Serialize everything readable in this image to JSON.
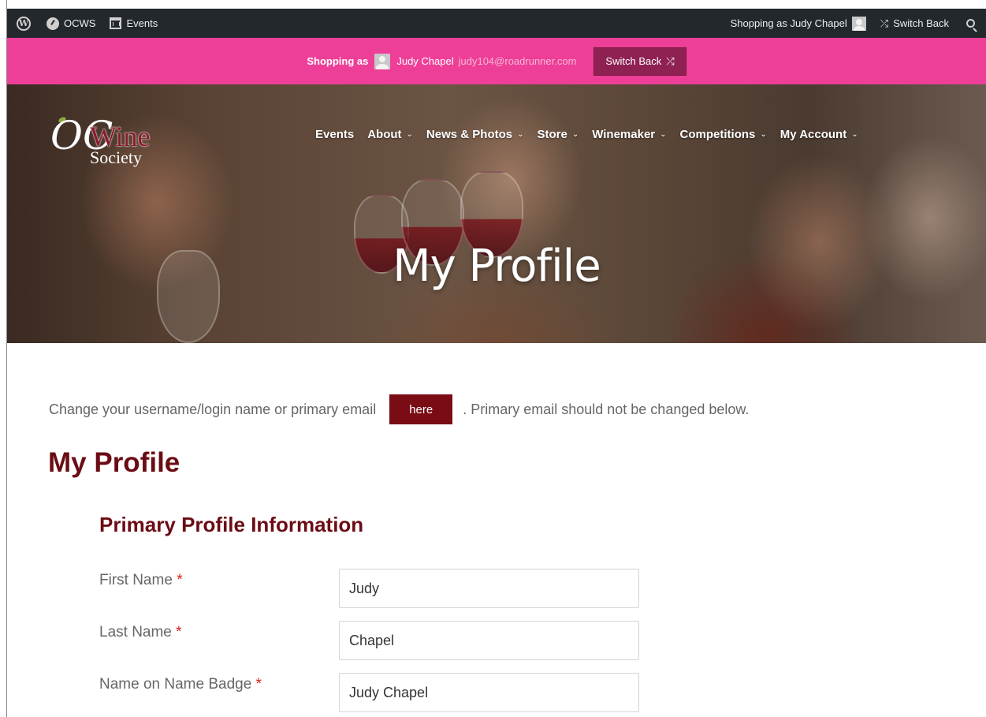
{
  "adminbar": {
    "site_name": "OCWS",
    "events_label": "Events",
    "shopping_as": "Shopping as Judy Chapel",
    "switch_back": "Switch Back"
  },
  "shopbar": {
    "label": "Shopping as",
    "name": "Judy Chapel",
    "email": "judy104@roadrunner.com",
    "switch_back": "Switch Back",
    "color": "#ee3f98",
    "button_color": "#8e2152"
  },
  "logo": {
    "oc": "OC",
    "wine": "Wine",
    "society": "Society"
  },
  "nav": {
    "items": [
      {
        "label": "Events",
        "dropdown": false
      },
      {
        "label": "About",
        "dropdown": true
      },
      {
        "label": "News & Photos",
        "dropdown": true
      },
      {
        "label": "Store",
        "dropdown": true
      },
      {
        "label": "Winemaker",
        "dropdown": true
      },
      {
        "label": "Competitions",
        "dropdown": true
      },
      {
        "label": "My Account",
        "dropdown": true
      }
    ],
    "chevron": "⌄"
  },
  "hero": {
    "title": "My Profile"
  },
  "notice": {
    "before": "Change your username/login name or primary email",
    "button": "here",
    "after": ". Primary email should not be changed below."
  },
  "page": {
    "heading": "My Profile",
    "section": "Primary Profile Information",
    "accent_color": "#6b0c14"
  },
  "form": {
    "required_mark": "*",
    "fields": [
      {
        "label": "First Name",
        "value": "Judy"
      },
      {
        "label": "Last Name",
        "value": "Chapel"
      },
      {
        "label": "Name on Name Badge",
        "value": "Judy Chapel"
      }
    ]
  }
}
